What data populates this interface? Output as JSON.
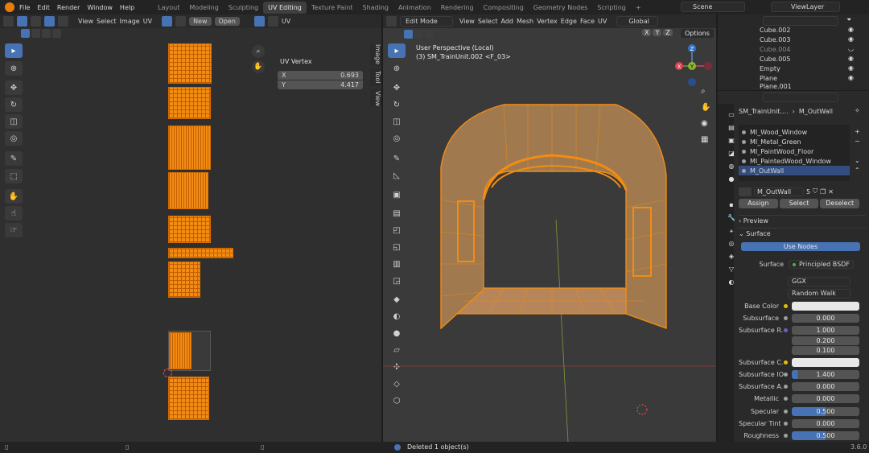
{
  "topbar": {
    "menus": [
      "File",
      "Edit",
      "Render",
      "Window",
      "Help"
    ],
    "workspaces": [
      "Layout",
      "Modeling",
      "Sculpting",
      "UV Editing",
      "Texture Paint",
      "Shading",
      "Animation",
      "Rendering",
      "Compositing",
      "Geometry Nodes",
      "Scripting",
      "+"
    ],
    "active_workspace": "UV Editing",
    "scene": "Scene",
    "view_layer": "ViewLayer"
  },
  "uv_editor": {
    "menus": [
      "View",
      "Select",
      "Image",
      "UV"
    ],
    "new_label": "New",
    "open_label": "Open",
    "uv_label": "UV",
    "panel_title": "UV Vertex",
    "x_label": "X",
    "x_value": "0.693",
    "y_label": "Y",
    "y_value": "4.417",
    "tabs": [
      "Image",
      "Tool",
      "View"
    ]
  },
  "viewport": {
    "mode": "Edit Mode",
    "menus": [
      "View",
      "Select",
      "Add",
      "Mesh",
      "Vertex",
      "Edge",
      "Face",
      "UV"
    ],
    "orientation": "Global",
    "options_label": "Options",
    "axes": [
      "X",
      "Y",
      "Z"
    ],
    "perspective": "User Perspective (Local)",
    "object_info": "(3) SM_TrainUnit.002 <F_03>",
    "gizmo": {
      "x": "X",
      "y": "Y",
      "z": "Z"
    }
  },
  "outliner": {
    "items": [
      {
        "name": "Cube.002"
      },
      {
        "name": "Cube.003"
      },
      {
        "name": "Cube.004"
      },
      {
        "name": "Cube.005"
      },
      {
        "name": "Empty"
      },
      {
        "name": "Plane"
      },
      {
        "name": "Plane.001"
      }
    ]
  },
  "properties": {
    "object": "SM_TrainUnit....",
    "material": "M_OutWall",
    "slots": [
      "MI_Wood_Window",
      "MI_Metal_Green",
      "MI_PaintWood_Floor",
      "MI_PaintedWood_Window",
      "M_OutWall"
    ],
    "material_field": "M_OutWall",
    "user_count": "5",
    "assign": "Assign",
    "select": "Select",
    "deselect": "Deselect",
    "preview": "Preview",
    "surface_section": "Surface",
    "use_nodes": "Use Nodes",
    "surface_label": "Surface",
    "surface_value": "Principled BSDF",
    "distribution": "GGX",
    "subsurface_method": "Random Walk",
    "params": [
      {
        "label": "Base Color",
        "value": ""
      },
      {
        "label": "Subsurface",
        "value": "0.000"
      },
      {
        "label": "Subsurface R...",
        "value": "1.000"
      },
      {
        "label": "",
        "value": "0.200"
      },
      {
        "label": "",
        "value": "0.100"
      },
      {
        "label": "Subsurface C...",
        "value": ""
      },
      {
        "label": "Subsurface IOR",
        "value": "1.400"
      },
      {
        "label": "Subsurface A...",
        "value": "0.000"
      },
      {
        "label": "Metallic",
        "value": "0.000"
      },
      {
        "label": "Specular",
        "value": "0.500"
      },
      {
        "label": "Specular Tint",
        "value": "0.000"
      },
      {
        "label": "Roughness",
        "value": "0.500"
      }
    ]
  },
  "status": {
    "message": "Deleted 1 object(s)",
    "version": "3.6.0"
  },
  "colors": {
    "accent": "#4772b3",
    "selection": "#f28c13"
  }
}
